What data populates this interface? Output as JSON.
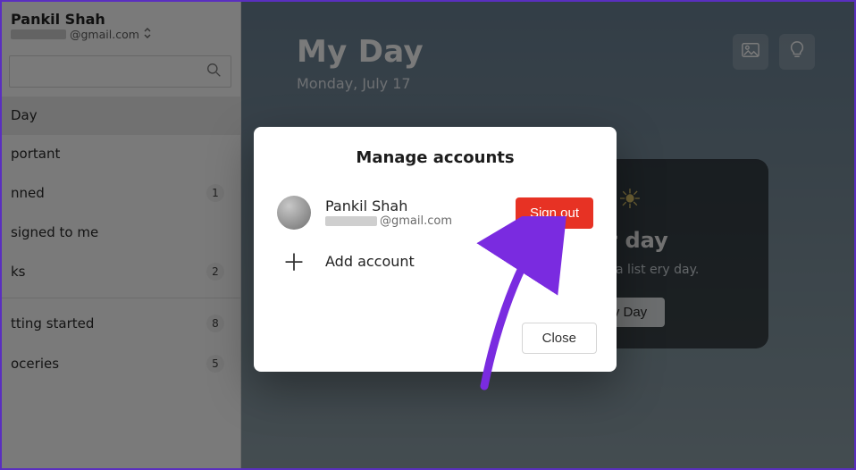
{
  "sidebar": {
    "account_name": "Pankil Shah",
    "account_email_suffix": "@gmail.com",
    "search_placeholder": "",
    "items": [
      {
        "label": "Day",
        "selected": true,
        "count": null
      },
      {
        "label": "portant",
        "selected": false,
        "count": null
      },
      {
        "label": "nned",
        "selected": false,
        "count": "1"
      },
      {
        "label": "signed to me",
        "selected": false,
        "count": null
      },
      {
        "label": "ks",
        "selected": false,
        "count": "2"
      }
    ],
    "user_lists": [
      {
        "label": "tting started",
        "count": "8"
      },
      {
        "label": "oceries",
        "count": "5"
      }
    ]
  },
  "main": {
    "title": "My Day",
    "date": "Monday, July 17",
    "promo": {
      "title": "ur day",
      "body": "My Day, a list ery day.",
      "button": "y Day"
    }
  },
  "dialog": {
    "title": "Manage accounts",
    "account_name": "Pankil Shah",
    "account_email_suffix": "@gmail.com",
    "signout_label": "Sign out",
    "add_account_label": "Add account",
    "close_label": "Close"
  },
  "colors": {
    "accent_red": "#e73224",
    "annotation_purple": "#7a2be0"
  }
}
